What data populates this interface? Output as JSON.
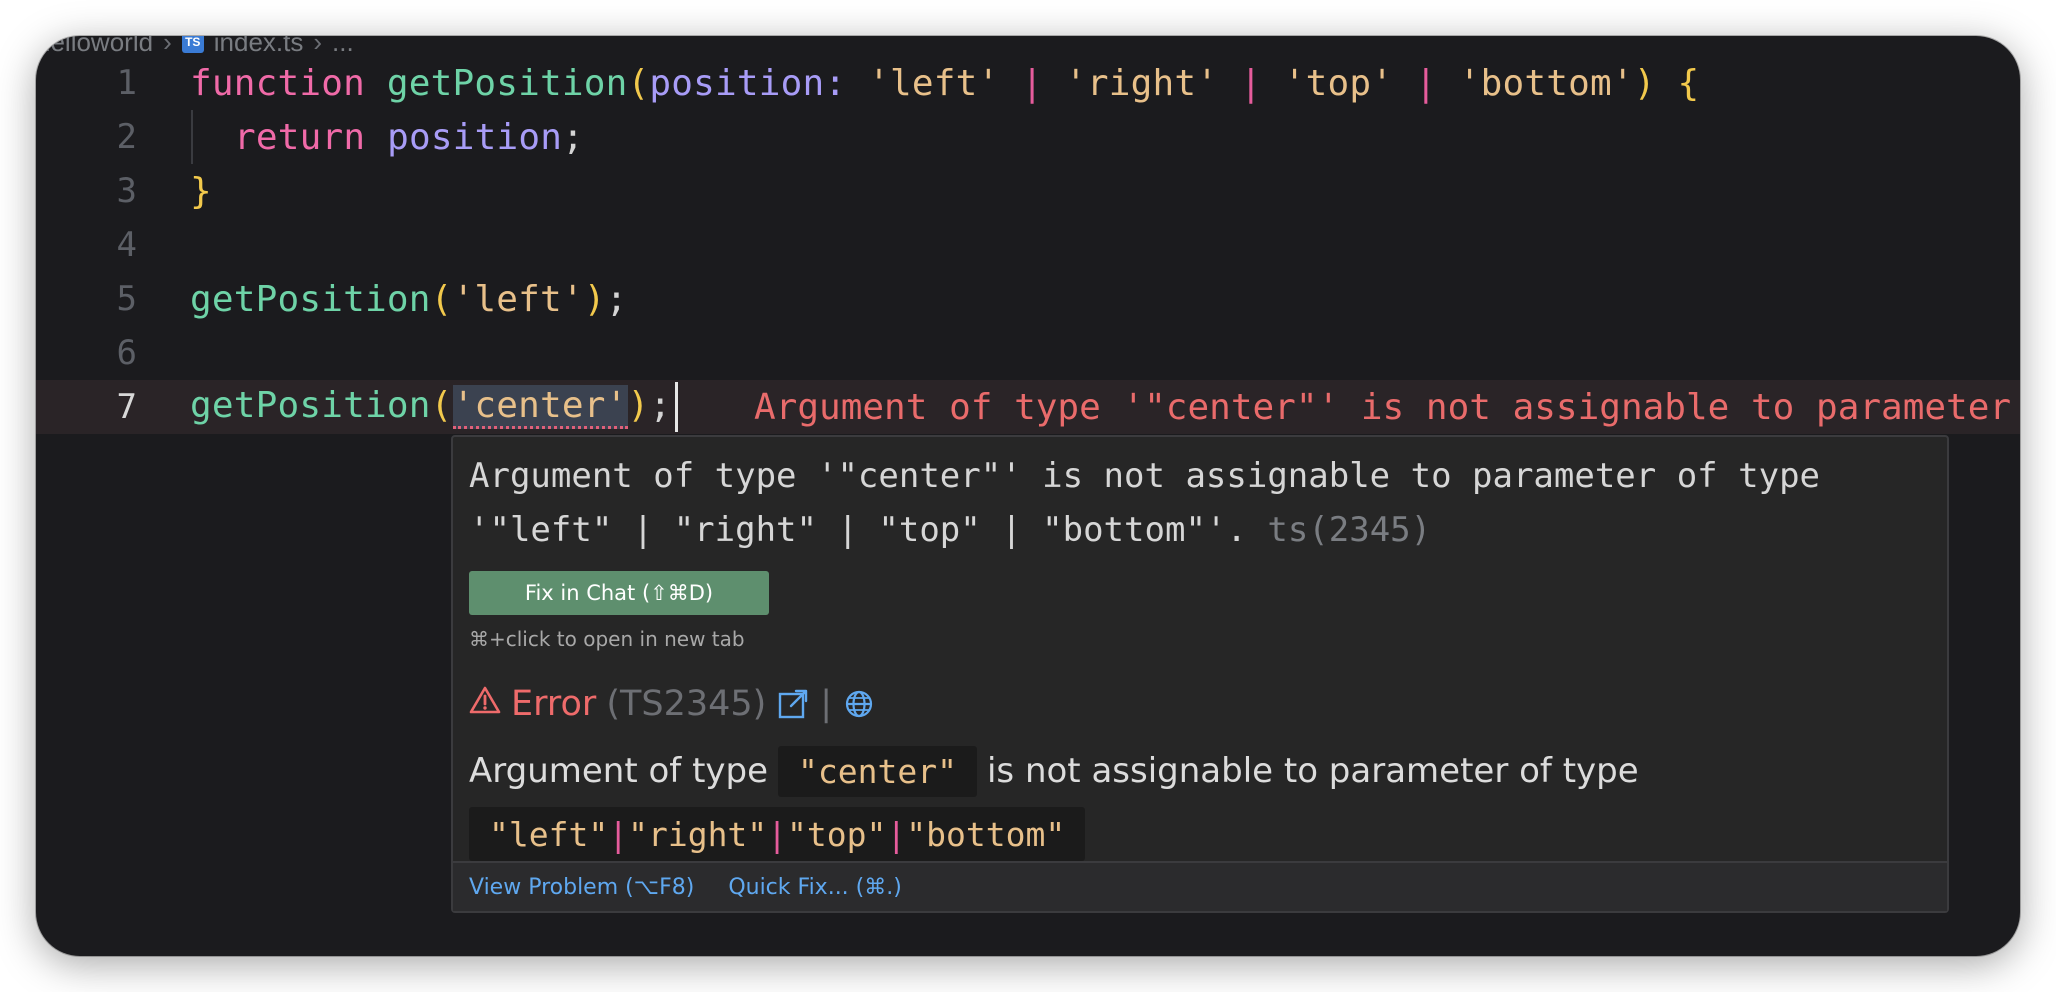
{
  "breadcrumb": {
    "folder": "helloworld",
    "separator": "›",
    "file_badge": "TS",
    "file": "index.ts",
    "tail": "..."
  },
  "editor": {
    "lines": [
      {
        "number": "1"
      },
      {
        "number": "2"
      },
      {
        "number": "3"
      },
      {
        "number": "4"
      },
      {
        "number": "5"
      },
      {
        "number": "6"
      },
      {
        "number": "7"
      }
    ],
    "tokens": {
      "kw_function": "function",
      "fn_name": "getPosition",
      "paren_open": "(",
      "paren_close": ")",
      "param_name": "position",
      "colon": ":",
      "str_left": "'left'",
      "str_right": "'right'",
      "str_top": "'top'",
      "str_bottom": "'bottom'",
      "str_center": "'center'",
      "pipe": "|",
      "brace_open": "{",
      "brace_close": "}",
      "kw_return": "return",
      "semicolon": ";"
    },
    "inline_error": "Argument of type '\"center\"' is not assignable to parameter"
  },
  "hover": {
    "message": "Argument of type '\"center\"' is not assignable to parameter of type '\"left\" | \"right\" | \"top\" | \"bottom\"'.",
    "code_ref": "ts(2345)",
    "fix_button": "Fix in Chat (⇧⌘D)",
    "hint": "⌘+click to open in new tab",
    "error_label": "Error",
    "error_code": "(TS2345)",
    "separator": "|",
    "desc_prefix": "Argument of type",
    "desc_chip": "\"center\"",
    "desc_suffix": "is not assignable to parameter of type",
    "types": {
      "left": "\"left\"",
      "right": "\"right\"",
      "top": "\"top\"",
      "bottom": "\"bottom\"",
      "pipe": "|"
    },
    "footer": {
      "view_problem": "View Problem (⌥F8)",
      "quick_fix": "Quick Fix... (⌘.)"
    }
  },
  "colors": {
    "background": "#1b1b1e",
    "keyword": "#f06aa8",
    "function": "#6ed3a7",
    "parameter": "#a89cf7",
    "string": "#e8c08a",
    "error": "#ee6b6b",
    "fix_button": "#5e8f6e",
    "link": "#5fa8f0"
  },
  "icons": {
    "error": "warning-triangle-icon",
    "external_link": "external-link-icon",
    "globe": "globe-icon",
    "file_type": "typescript-file-icon"
  }
}
